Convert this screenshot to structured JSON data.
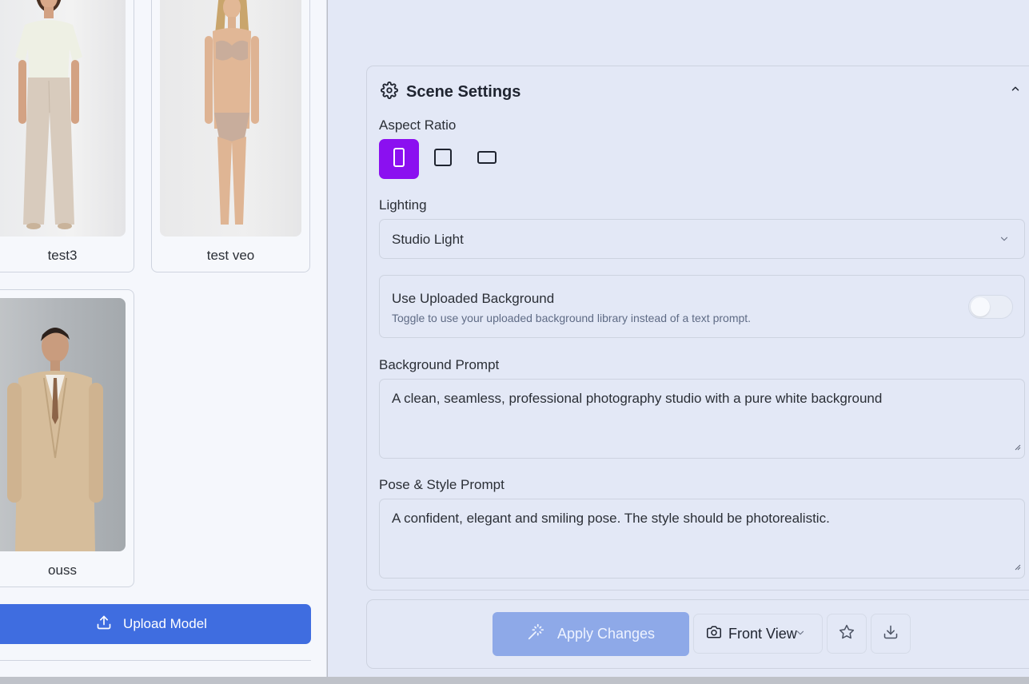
{
  "models": [
    {
      "name": "test3"
    },
    {
      "name": "test veo"
    },
    {
      "name": "ouss"
    }
  ],
  "sidebar": {
    "upload_label": "Upload Model"
  },
  "scene_settings": {
    "title": "Scene Settings",
    "aspect_ratio_label": "Aspect Ratio",
    "aspect_ratio_selected": "portrait",
    "lighting_label": "Lighting",
    "lighting_value": "Studio Light",
    "use_background": {
      "title": "Use Uploaded Background",
      "description": "Toggle to use your uploaded background library instead of a text prompt.",
      "enabled": false
    },
    "background_prompt_label": "Background Prompt",
    "background_prompt": "A clean, seamless, professional photography studio with a pure white background",
    "pose_prompt_label": "Pose & Style Prompt",
    "pose_prompt": "A confident, elegant and smiling pose. The style should be photorealistic."
  },
  "actions": {
    "apply_label": "Apply Changes",
    "view_value": "Front View"
  },
  "colors": {
    "accent": "#8b10f0",
    "primary": "#3f6de0",
    "apply_disabled": "#8ea9e8"
  }
}
